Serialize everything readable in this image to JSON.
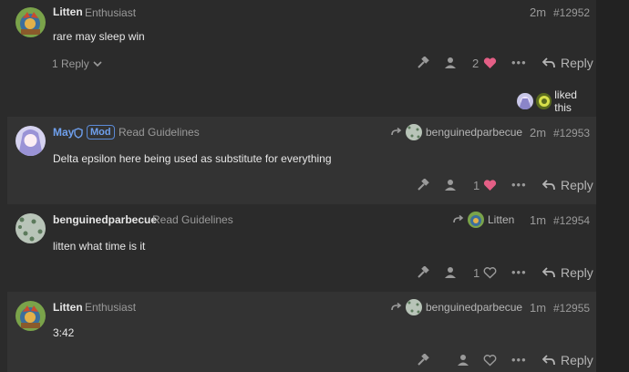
{
  "posts": [
    {
      "username": "Litten",
      "user_title": "Enthusiast",
      "time": "2m",
      "post_number": "#12952",
      "body": "rare may sleep win",
      "likes_count": "2",
      "replies": "1 Reply",
      "reply_label": "Reply",
      "liked_by_text": "liked this"
    },
    {
      "username": "May",
      "badge": "Mod",
      "user_title": "Read Guidelines",
      "reply_to_user": "benguinedparbecue",
      "time": "2m",
      "post_number": "#12953",
      "body": "Delta epsilon here being used as substitute for everything",
      "likes_count": "1",
      "reply_label": "Reply"
    },
    {
      "username": "benguinedparbecue",
      "user_title": "Read Guidelines",
      "reply_to_user": "Litten",
      "time": "1m",
      "post_number": "#12954",
      "body": "litten what time is it",
      "likes_count": "1",
      "reply_label": "Reply"
    },
    {
      "username": "Litten",
      "user_title": "Enthusiast",
      "reply_to_user": "benguinedparbecue",
      "time": "1m",
      "post_number": "#12955",
      "body": "3:42",
      "reply_label": "Reply"
    }
  ],
  "colors": {
    "heart_liked": "#e45f86",
    "mod_blue": "#6fa0ee",
    "muted": "#9a9a9a"
  }
}
